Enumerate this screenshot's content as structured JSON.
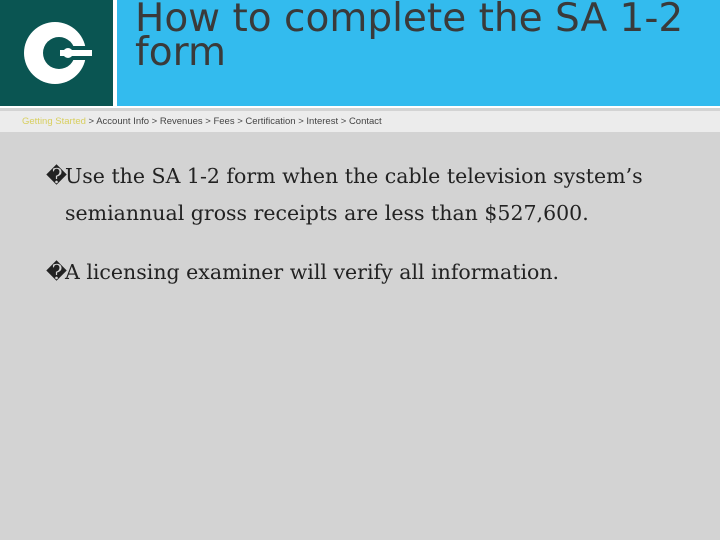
{
  "slide": {
    "title": "How to complete the SA 1-2 form",
    "logo_icon": "c-logo-icon",
    "colors": {
      "logo_background": "#0a5552",
      "title_background": "#33bbee",
      "breadcrumb_active": "#d8cf60",
      "body_background": "#d3d3d3"
    }
  },
  "breadcrumb": {
    "items": [
      {
        "label": "Getting Started",
        "active": true
      },
      {
        "label": "Account Info",
        "active": false
      },
      {
        "label": "Revenues",
        "active": false
      },
      {
        "label": "Fees",
        "active": false
      },
      {
        "label": "Certification",
        "active": false
      },
      {
        "label": "Interest",
        "active": false
      },
      {
        "label": "Contact",
        "active": false
      }
    ],
    "separator": " > "
  },
  "bullets": {
    "marker": "�",
    "items": [
      "Use the SA 1-2 form when the cable television system’s semiannual gross receipts   are less than $527,600.",
      "A licensing examiner will verify all information."
    ]
  }
}
